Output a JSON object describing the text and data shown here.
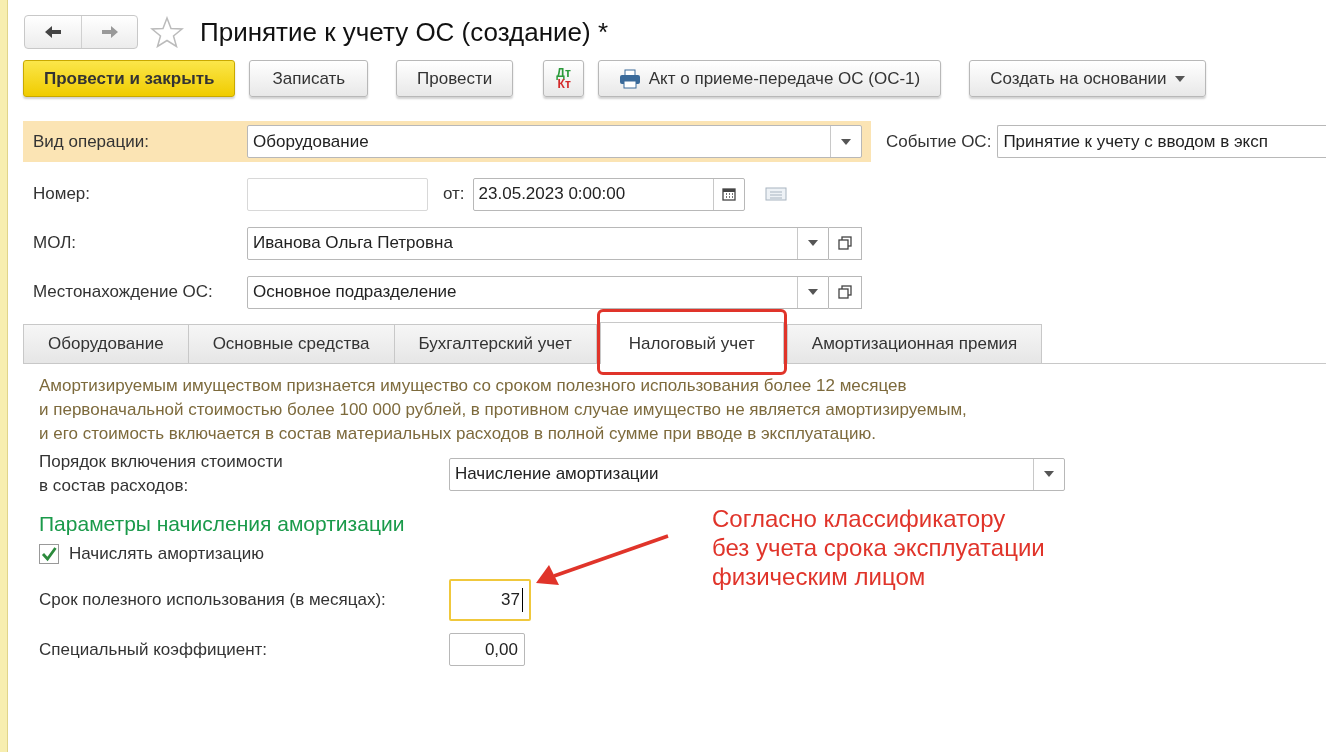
{
  "window": {
    "title": "Принятие к учету ОС (создание) *"
  },
  "toolbar": [
    {
      "kind": "primary",
      "label": "Провести и закрыть"
    },
    {
      "kind": "plain",
      "label": "Записать"
    },
    {
      "kind": "plain",
      "label": "Провести"
    },
    {
      "kind": "dtkt",
      "label_top": "Дт",
      "label_bottom": "Кт"
    },
    {
      "kind": "print",
      "label": "Акт о приеме-передаче ОС (ОС-1)"
    },
    {
      "kind": "menu",
      "label": "Создать на основании"
    }
  ],
  "operation": {
    "label": "Вид операции:",
    "value": "Оборудование",
    "event_label": "Событие ОС:",
    "event_value": "Принятие к учету с вводом в эксп"
  },
  "number": {
    "label": "Номер:",
    "date_label": "от:",
    "date_value": "23.05.2023  0:00:00"
  },
  "mol": {
    "label": "МОЛ:",
    "value": "Иванова Ольга Петровна"
  },
  "location": {
    "label": "Местонахождение ОС:",
    "value": "Основное подразделение"
  },
  "tabs": [
    {
      "label": "Оборудование",
      "selected": false
    },
    {
      "label": "Основные средства",
      "selected": false
    },
    {
      "label": "Бухгалтерский учет",
      "selected": false
    },
    {
      "label": "Налоговый учет",
      "selected": true
    },
    {
      "label": "Амортизационная премия",
      "selected": false
    }
  ],
  "info_text": "Амортизируемым имуществом признается имущество со сроком полезного использования более 12 месяцев\nи первоначальной стоимостью более 100 000 рублей, в противном случае имущество не является амортизируемым,\nи его стоимость включается в состав материальных расходов в полной сумме при вводе в эксплуатацию.",
  "expense_order": {
    "label": "Порядок включения стоимости\nв состав расходов:",
    "value": "Начисление амортизации"
  },
  "depreciation": {
    "heading": "Параметры начисления амортизации",
    "checkbox_label": "Начислять амортизацию",
    "checked": true,
    "life_label": "Срок полезного использования (в месяцах):",
    "life_value": "37",
    "coef_label": "Специальный коэффициент:",
    "coef_value": "0,00"
  },
  "annotation": {
    "text": "Согласно классификатору\nбез учета срока эксплуатации\nфизическим лицом"
  }
}
